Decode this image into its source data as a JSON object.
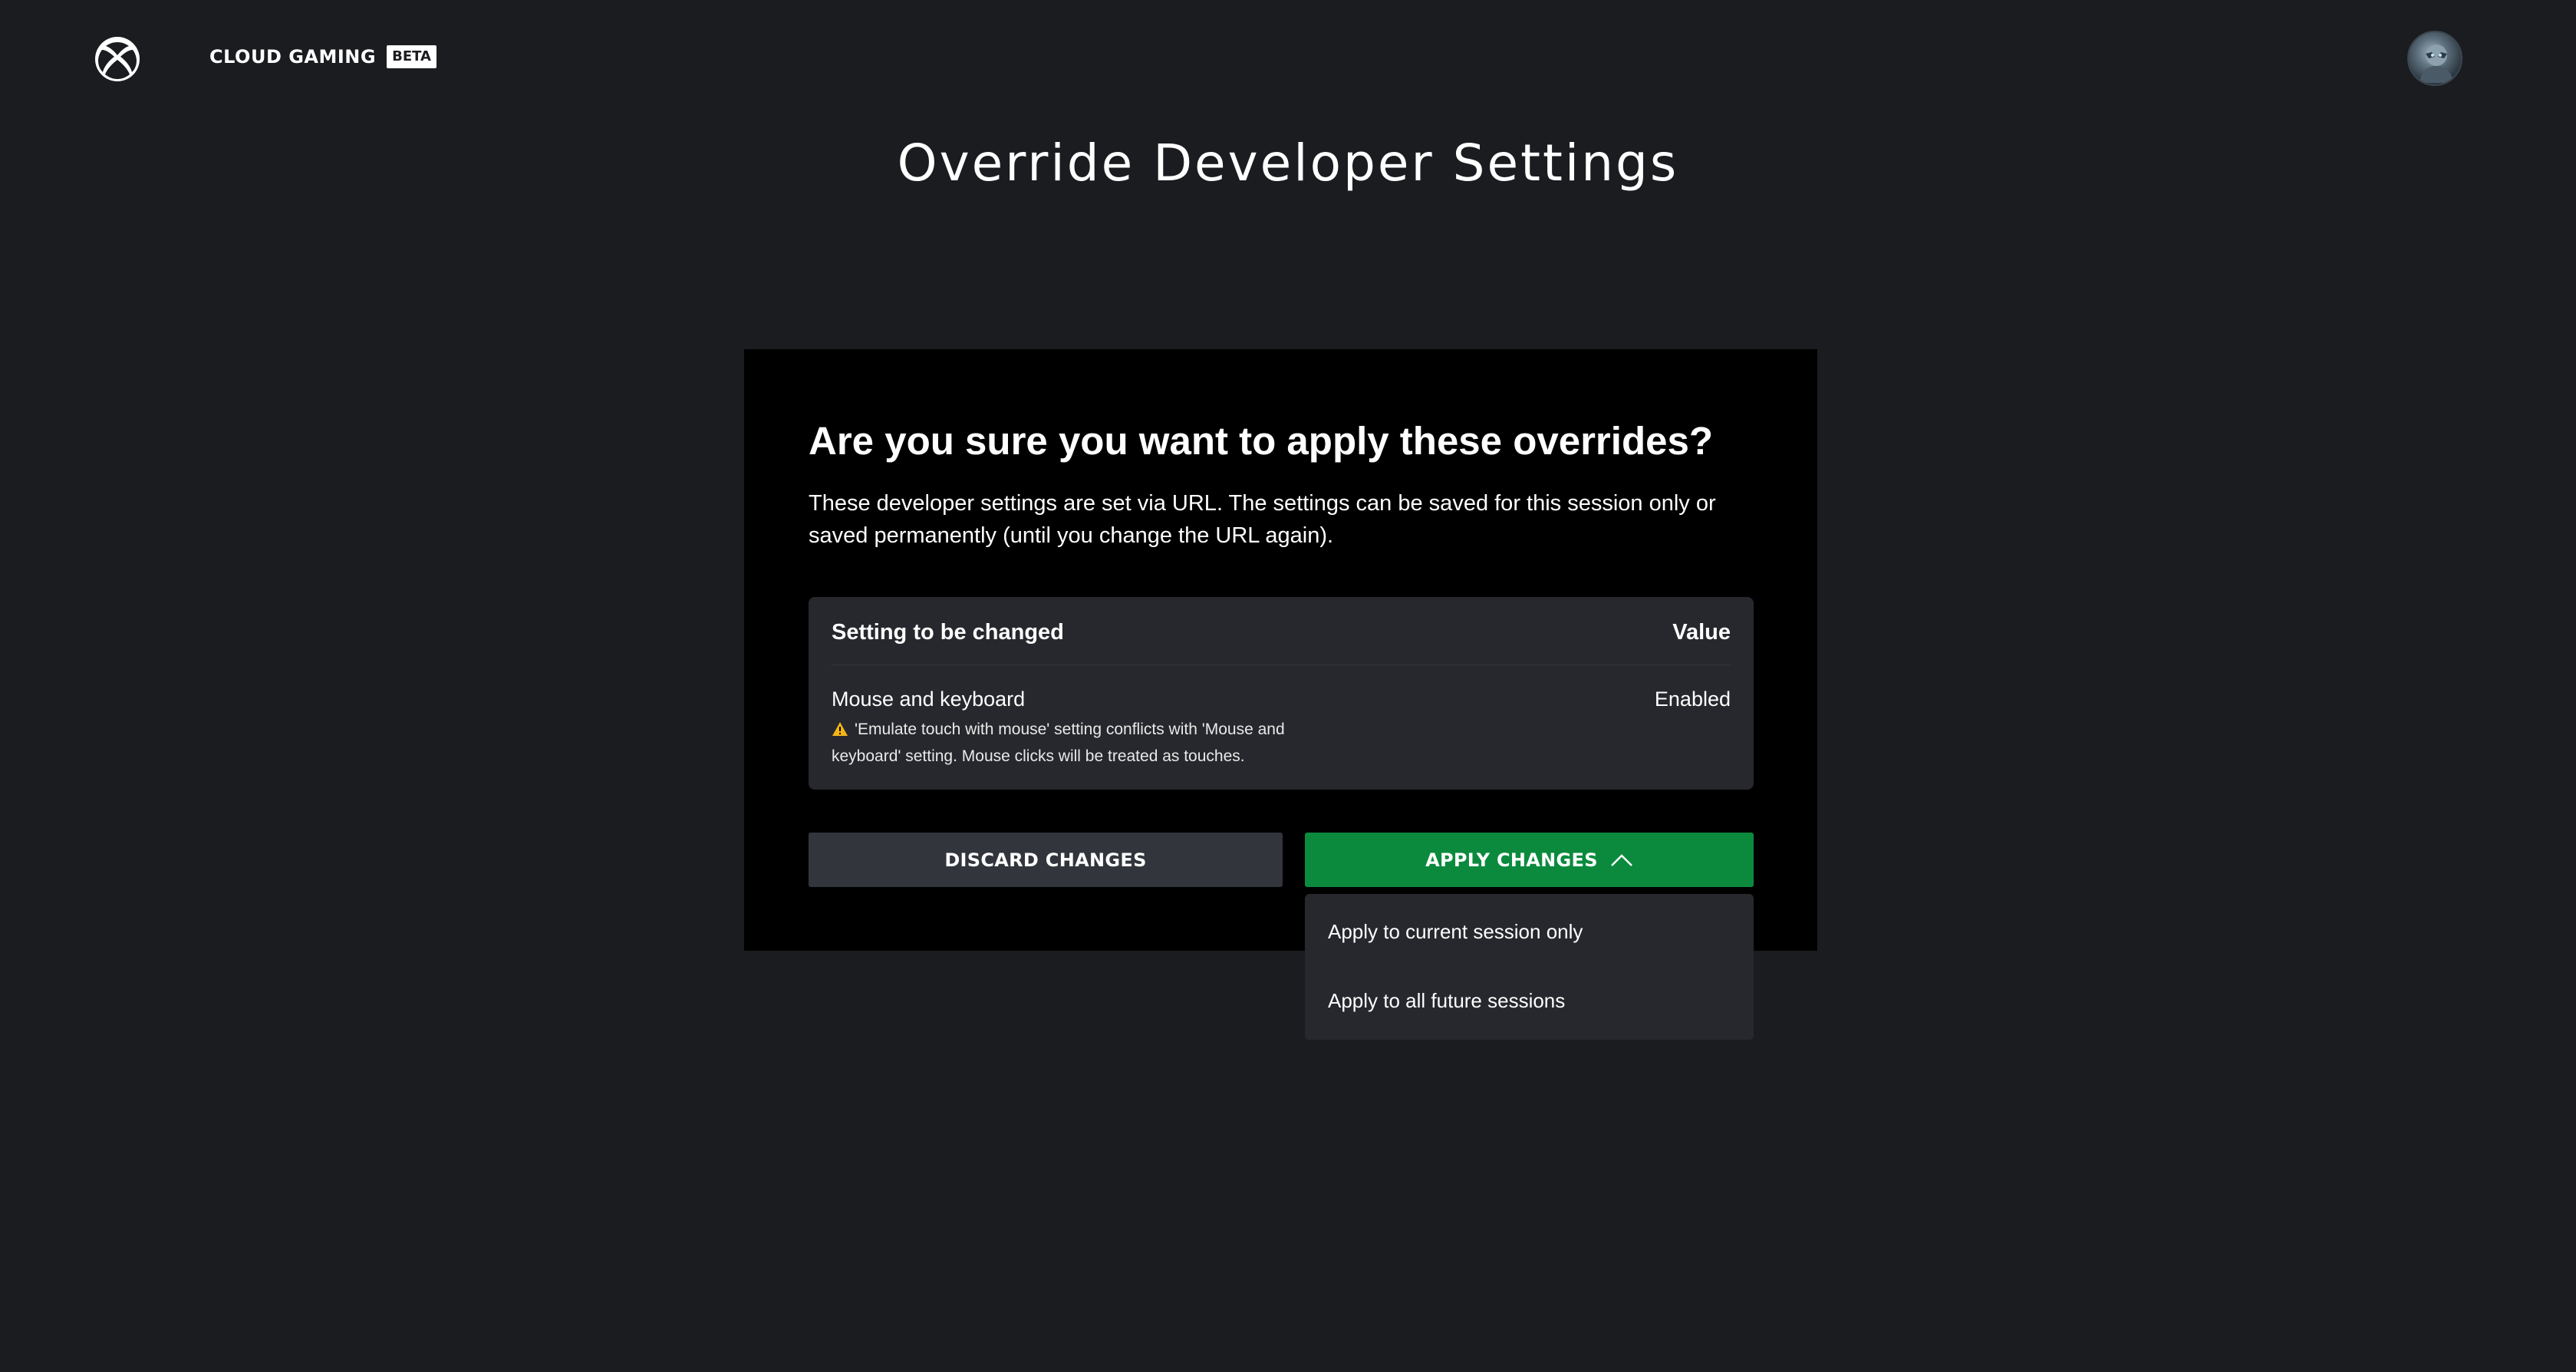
{
  "header": {
    "logo_icon": "xbox-logo-icon",
    "brand": "CLOUD GAMING",
    "badge": "BETA",
    "avatar_icon": "user-avatar-icon"
  },
  "page": {
    "title": "Override Developer Settings"
  },
  "dialog": {
    "heading": "Are you sure you want to apply these overrides?",
    "description": "These developer settings are set via URL. The settings can be saved for this session only or saved permanently (until you change the URL again).",
    "table": {
      "col_setting": "Setting to be changed",
      "col_value": "Value",
      "rows": [
        {
          "name": "Mouse and keyboard",
          "value": "Enabled",
          "warning_icon": "warning-icon",
          "warning": "'Emulate touch with mouse' setting conflicts with 'Mouse and keyboard' setting. Mouse clicks will be treated as touches."
        }
      ]
    },
    "discard_label": "DISCARD CHANGES",
    "apply_label": "APPLY CHANGES",
    "apply_icon": "chevron-up-icon",
    "dropdown": [
      "Apply to current session only",
      "Apply to all future sessions"
    ]
  },
  "colors": {
    "background": "#1b1c20",
    "dialog": "#000000",
    "panel": "#26282d",
    "accent_green": "#0b8a3e",
    "warning": "#f2b417"
  }
}
